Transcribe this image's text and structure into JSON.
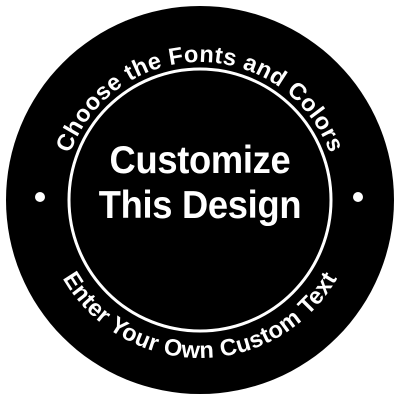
{
  "sticker": {
    "shape": "circle",
    "top_arc_text": "Choose the Fonts and Colors",
    "bottom_arc_text": "Enter Your Own Custom Text",
    "center_line_1": "Customize",
    "center_line_2": "This Design",
    "colors": {
      "background": "#ffffff",
      "disc": "#000000",
      "ring": "#ffffff",
      "text": "#ffffff",
      "dots": "#ffffff"
    },
    "dot_icons": [
      "left-dot-icon",
      "right-dot-icon"
    ]
  }
}
